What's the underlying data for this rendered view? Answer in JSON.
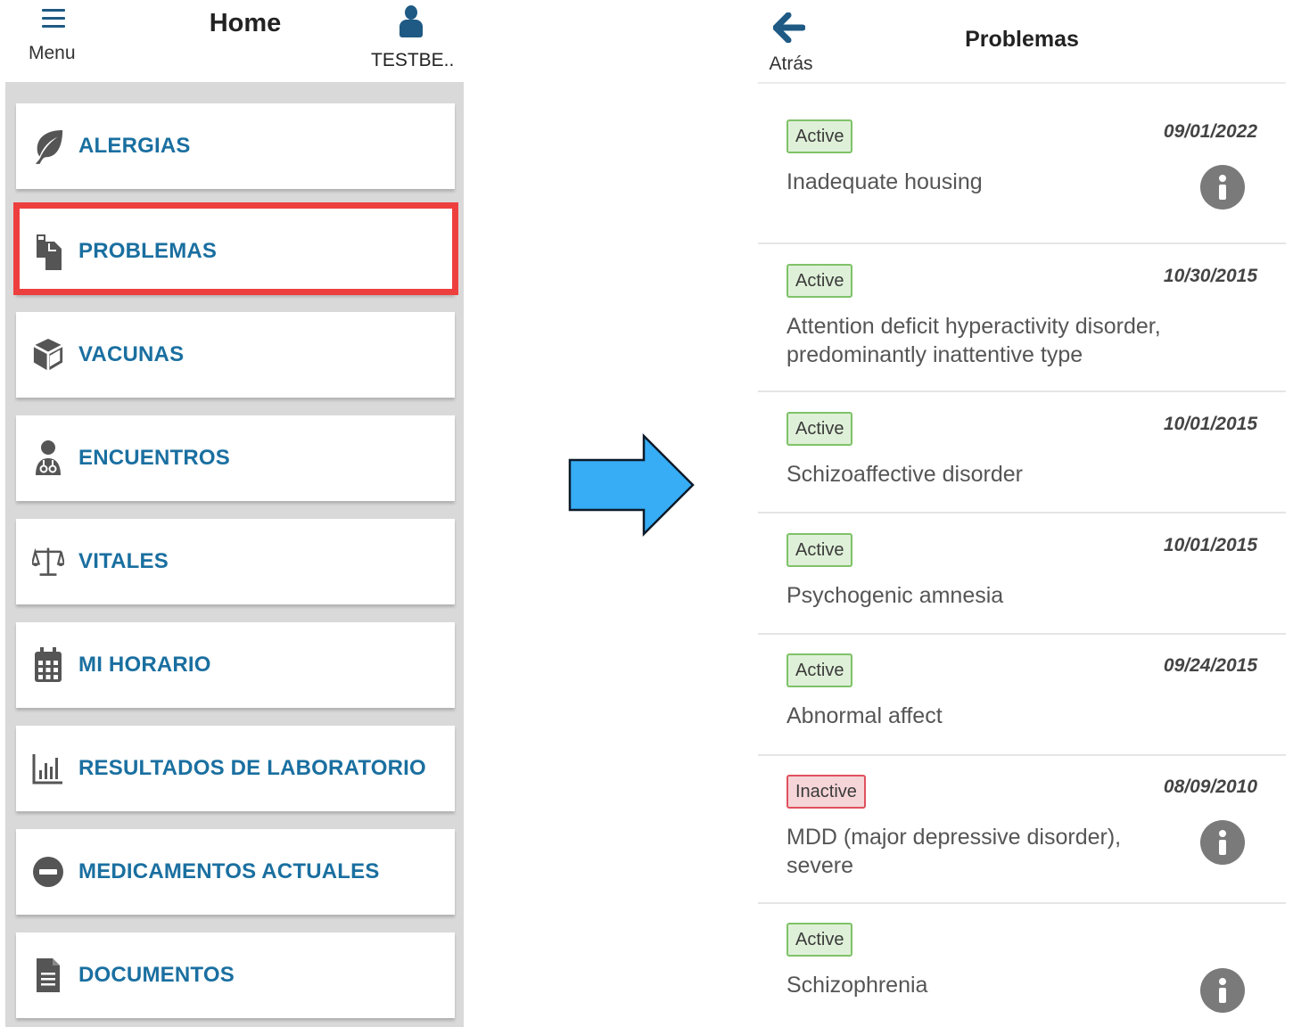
{
  "left": {
    "header": {
      "menu_label": "Menu",
      "title": "Home",
      "user_label": "TESTBE.."
    },
    "items": [
      {
        "label": "ALERGIAS",
        "icon": "leaf-icon"
      },
      {
        "label": "PROBLEMAS",
        "icon": "clipboard-copy-icon",
        "highlighted": true
      },
      {
        "label": "VACUNAS",
        "icon": "cube-icon"
      },
      {
        "label": "ENCUENTROS",
        "icon": "doctor-icon"
      },
      {
        "label": "VITALES",
        "icon": "balance-scale-icon"
      },
      {
        "label": "MI HORARIO",
        "icon": "calendar-icon"
      },
      {
        "label": "RESULTADOS DE LABORATORIO",
        "icon": "bar-chart-icon"
      },
      {
        "label": "MEDICAMENTOS ACTUALES",
        "icon": "minus-circle-icon"
      },
      {
        "label": "DOCUMENTOS",
        "icon": "document-icon"
      }
    ]
  },
  "right": {
    "header": {
      "back_label": "Atrás",
      "title": "Problemas"
    },
    "problems": [
      {
        "status": "Active",
        "date": "09/01/2022",
        "name": "Inadequate housing",
        "info": true
      },
      {
        "status": "Active",
        "date": "10/30/2015",
        "name": "Attention deficit hyperactivity disorder, predominantly inattentive type",
        "info": false
      },
      {
        "status": "Active",
        "date": "10/01/2015",
        "name": "Schizoaffective disorder",
        "info": false
      },
      {
        "status": "Active",
        "date": "10/01/2015",
        "name": "Psychogenic amnesia",
        "info": false
      },
      {
        "status": "Active",
        "date": "09/24/2015",
        "name": "Abnormal affect",
        "info": false
      },
      {
        "status": "Inactive",
        "date": "08/09/2010",
        "name": "MDD (major depressive disorder), severe",
        "info": true
      },
      {
        "status": "Active",
        "date": "",
        "name": "Schizophrenia",
        "info": true
      }
    ]
  },
  "colors": {
    "menu_text": "#1a6fa0",
    "icon_navy": "#1e5a84",
    "highlight": "#ee3f3f",
    "arrow_fill": "#36adf5",
    "active_bg": "#dff0d8",
    "active_border": "#7fc268",
    "inactive_bg": "#f5d5d8",
    "inactive_border": "#e0505e"
  }
}
